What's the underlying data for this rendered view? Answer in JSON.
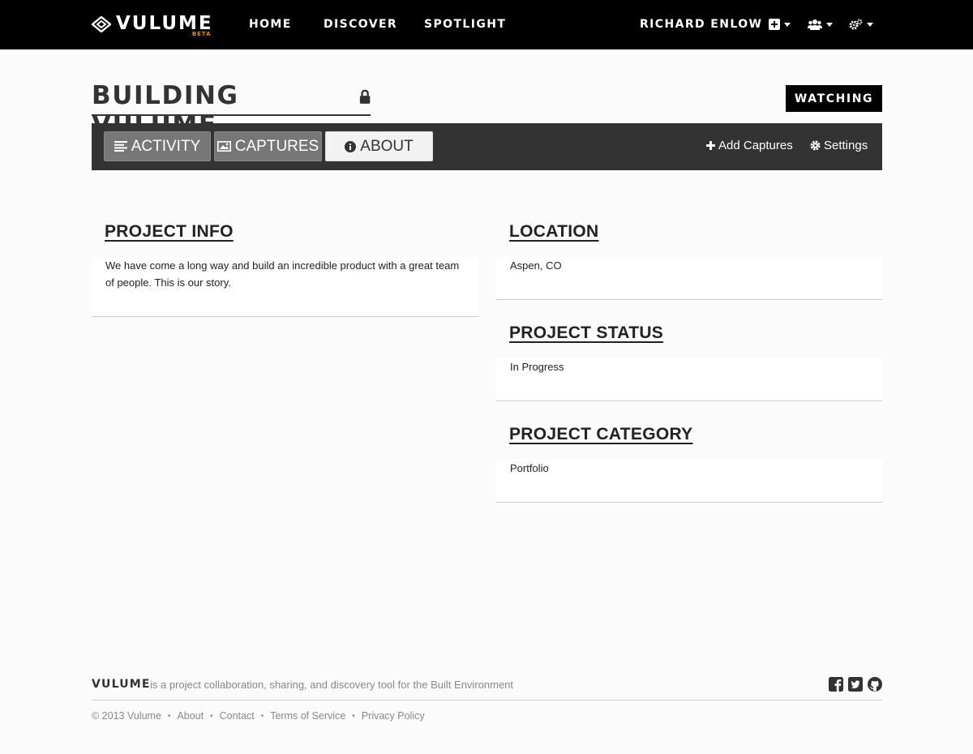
{
  "header": {
    "logo_text": "VULUME",
    "logo_badge": "BETA",
    "nav": [
      "HOME",
      "DISCOVER",
      "SPOTLIGHT"
    ],
    "user_name": "RICHARD ENLOW",
    "icons": [
      "plus-square-icon",
      "users-icon",
      "gears-icon"
    ]
  },
  "project": {
    "title": "BUILDING VULUME",
    "lock_icon": "lock-icon",
    "watch_label": "WATCHING"
  },
  "tabs": [
    {
      "label": "ACTIVITY",
      "icon": "list-icon",
      "active": false
    },
    {
      "label": "CAPTURES",
      "icon": "picture-icon",
      "active": false
    },
    {
      "label": "ABOUT",
      "icon": "info-icon",
      "active": true
    }
  ],
  "tools": {
    "add_captures": "Add Captures",
    "settings": "Settings"
  },
  "sections": {
    "info_title": "PROJECT INFO",
    "info_body": "We have come a long way and build an incredible product with a great team of people. This is our story.",
    "location_title": "LOCATION",
    "location_value": "Aspen, CO",
    "status_title": "PROJECT STATUS",
    "status_value": "In Progress",
    "category_title": "PROJECT CATEGORY",
    "category_value": "Portfolio"
  },
  "footer": {
    "brand": "VULUME",
    "tagline": "is a project collaboration, sharing, and discovery tool for the Built Environment",
    "copyright": "© 2013 Vulume",
    "links": [
      "About",
      "Contact",
      "Terms of Service",
      "Privacy Policy"
    ],
    "social_icons": [
      "facebook-icon",
      "twitter-icon",
      "github-icon"
    ]
  },
  "colors": {
    "topbar": "#000000",
    "tabbar": "#333333",
    "beta_accent": "#e58a1f",
    "background": "#fbfbfb"
  }
}
